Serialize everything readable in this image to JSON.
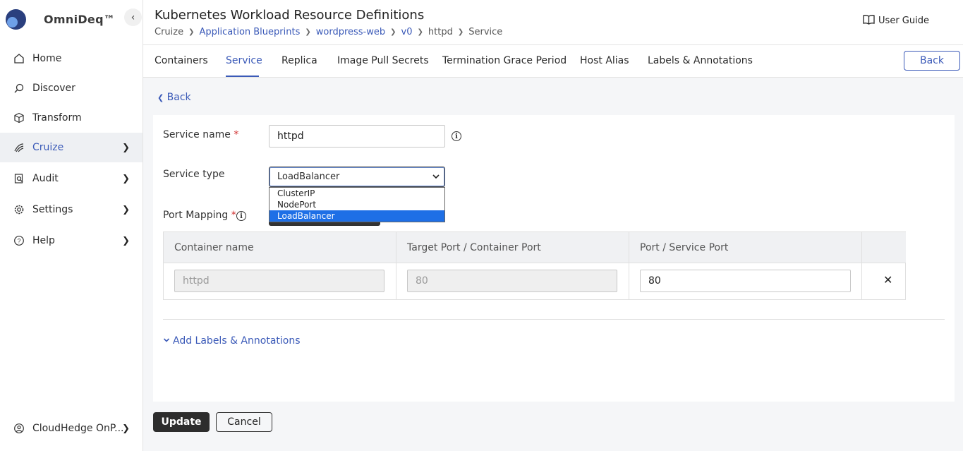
{
  "app": {
    "name": "OmniDeq™"
  },
  "sidebar": {
    "items": [
      {
        "label": "Home",
        "icon": "home-icon"
      },
      {
        "label": "Discover",
        "icon": "discover-icon"
      },
      {
        "label": "Transform",
        "icon": "transform-icon"
      },
      {
        "label": "Cruize",
        "icon": "cruize-icon",
        "active": true
      },
      {
        "label": "Audit",
        "icon": "audit-icon"
      },
      {
        "label": "Settings",
        "icon": "settings-icon"
      },
      {
        "label": "Help",
        "icon": "help-icon"
      }
    ],
    "account": {
      "label": "CloudHedge OnP..."
    }
  },
  "header": {
    "title": "Kubernetes Workload Resource Definitions",
    "breadcrumb": [
      "Cruize",
      "Application Blueprints",
      "wordpress-web",
      "v0",
      "httpd",
      "Service"
    ],
    "user_guide": "User Guide"
  },
  "tabs": {
    "items": [
      "Containers",
      "Service",
      "Replica",
      "Image Pull Secrets",
      "Termination Grace Period",
      "Host Alias",
      "Labels & Annotations"
    ],
    "active": "Service",
    "back_label": "Back"
  },
  "form": {
    "back_link": "Back",
    "service_name_label": "Service name",
    "service_name_value": "httpd",
    "service_type_label": "Service type",
    "service_type_value": "LoadBalancer",
    "service_type_options": [
      "ClusterIP",
      "NodePort",
      "LoadBalancer"
    ],
    "port_mapping_label": "Port Mapping",
    "required_mark": "*",
    "info_glyph": "i",
    "table": {
      "headers": [
        "Container name",
        "Target Port / Container Port",
        "Port / Service Port"
      ],
      "rows": [
        {
          "container_name": "httpd",
          "target_port": "80",
          "service_port": "80"
        }
      ]
    },
    "add_labels": "Add Labels & Annotations"
  },
  "actions": {
    "update": "Update",
    "cancel": "Cancel"
  },
  "colors": {
    "accent": "#3b5ab8",
    "primary_button": "#2d2d2d",
    "selected_option": "#1e6fe6"
  }
}
